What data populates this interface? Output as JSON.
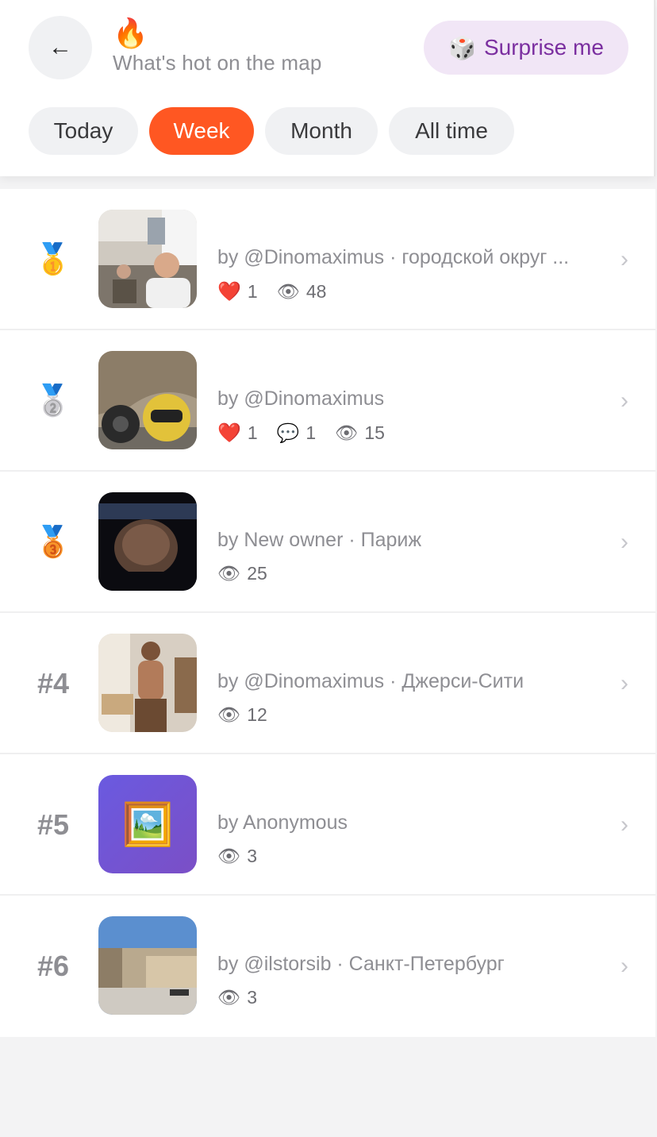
{
  "header": {
    "back_icon": "←",
    "fire_icon": "🔥",
    "subtitle": "What's hot on the map",
    "surprise": {
      "icon": "🎲",
      "label": "Surprise me"
    }
  },
  "tabs": [
    {
      "label": "Today",
      "active": false
    },
    {
      "label": "Week",
      "active": true
    },
    {
      "label": "Month",
      "active": false
    },
    {
      "label": "All time",
      "active": false
    }
  ],
  "items": [
    {
      "rank": "🥇",
      "meta": "by @Dinomaximus · городской округ ...",
      "likes": "1",
      "views": "48"
    },
    {
      "rank": "🥈",
      "meta": "by @Dinomaximus",
      "likes": "1",
      "comments": "1",
      "views": "15"
    },
    {
      "rank": "🥉",
      "meta": "by New owner · Париж",
      "views": "25"
    },
    {
      "rank": "#4",
      "meta": "by @Dinomaximus · Джерси-Сити",
      "views": "12"
    },
    {
      "rank": "#5",
      "meta": "by Anonymous",
      "views": "3",
      "placeholder_icon": "🖼️"
    },
    {
      "rank": "#6",
      "meta": "by @ilstorsib · Санкт-Петербург",
      "views": "3"
    }
  ],
  "icons": {
    "heart": "❤️",
    "comment": "💬",
    "eye": "👁",
    "chevron": "›"
  },
  "colors": {
    "accent": "#ff5722",
    "surprise_bg": "#f1e6f6",
    "surprise_text": "#7b2fa0",
    "placeholder_bg": "#6a4fd1"
  }
}
